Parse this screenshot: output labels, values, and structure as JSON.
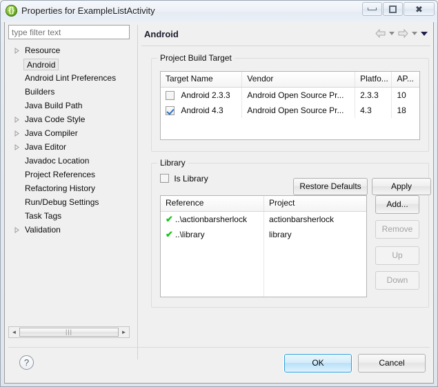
{
  "window": {
    "title": "Properties for ExampleListActivity",
    "icon": "properties-braces-icon",
    "controls": {
      "minimize": "–",
      "maximize": "□",
      "close": "✕"
    }
  },
  "sidebar": {
    "filter": {
      "placeholder": "type filter text",
      "value": ""
    },
    "items": [
      {
        "label": "Resource",
        "expandable": true,
        "selected": false
      },
      {
        "label": "Android",
        "expandable": false,
        "selected": true
      },
      {
        "label": "Android Lint Preferences",
        "expandable": false,
        "selected": false
      },
      {
        "label": "Builders",
        "expandable": false,
        "selected": false
      },
      {
        "label": "Java Build Path",
        "expandable": false,
        "selected": false
      },
      {
        "label": "Java Code Style",
        "expandable": true,
        "selected": false
      },
      {
        "label": "Java Compiler",
        "expandable": true,
        "selected": false
      },
      {
        "label": "Java Editor",
        "expandable": true,
        "selected": false
      },
      {
        "label": "Javadoc Location",
        "expandable": false,
        "selected": false
      },
      {
        "label": "Project References",
        "expandable": false,
        "selected": false
      },
      {
        "label": "Refactoring History",
        "expandable": false,
        "selected": false
      },
      {
        "label": "Run/Debug Settings",
        "expandable": false,
        "selected": false
      },
      {
        "label": "Task Tags",
        "expandable": false,
        "selected": false
      },
      {
        "label": "Validation",
        "expandable": true,
        "selected": false
      }
    ],
    "scrollbar": {
      "left_arrow": "◄",
      "right_arrow": "►",
      "grip": "|||"
    }
  },
  "panel": {
    "title": "Android",
    "nav": {
      "back": "back-arrow",
      "forward": "forward-arrow",
      "menu": "chevron-down"
    }
  },
  "build_target": {
    "group_label": "Project Build Target",
    "columns": [
      "Target Name",
      "Vendor",
      "Platfo...",
      "AP..."
    ],
    "rows": [
      {
        "checked": false,
        "name": "Android 2.3.3",
        "vendor": "Android Open Source Pr...",
        "platform": "2.3.3",
        "api": "10"
      },
      {
        "checked": true,
        "name": "Android 4.3",
        "vendor": "Android Open Source Pr...",
        "platform": "4.3",
        "api": "18"
      }
    ]
  },
  "library": {
    "group_label": "Library",
    "is_library": {
      "label": "Is Library",
      "checked": false
    },
    "columns": [
      "Reference",
      "Project"
    ],
    "rows": [
      {
        "status": "✔",
        "reference": "..\\actionbarsherlock",
        "project": "actionbarsherlock"
      },
      {
        "status": "✔",
        "reference": "..\\library",
        "project": "library"
      }
    ],
    "buttons": [
      {
        "label": "Add...",
        "enabled": true
      },
      {
        "label": "Remove",
        "enabled": false
      },
      {
        "label": "Up",
        "enabled": false
      },
      {
        "label": "Down",
        "enabled": false
      }
    ]
  },
  "page_actions": {
    "restore_defaults": "Restore Defaults",
    "apply": "Apply"
  },
  "footer": {
    "help": "?",
    "ok": "OK",
    "cancel": "Cancel"
  },
  "colors": {
    "accent": "#2c9bd6",
    "check_green": "#19c419",
    "checkbox_blue": "#2a6fc9"
  }
}
